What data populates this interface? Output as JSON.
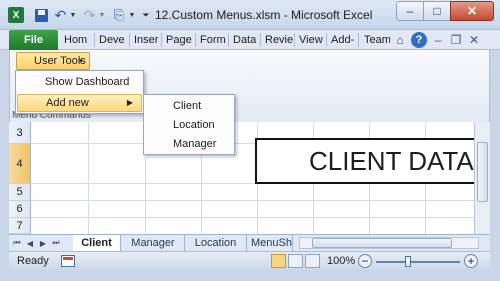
{
  "titlebar": {
    "app_icon": "excel-logo-icon",
    "app_icon_letter": "X",
    "title": "12.Custom Menus.xlsm - Microsoft Excel",
    "minimize": "–",
    "maximize": "□",
    "close": "✕"
  },
  "ribbon": {
    "file_tab": "File",
    "tabs": [
      "Hom",
      "Deve",
      "Inser",
      "Page",
      "Form",
      "Data",
      "Revie",
      "View",
      "Add-",
      "Team"
    ],
    "help_icon": "?",
    "window_controls": [
      "–",
      "❐",
      "✕"
    ]
  },
  "addins_group": {
    "user_tools_label": "User Tools",
    "group_label": "Menu Commands"
  },
  "user_tools_menu": {
    "items": [
      {
        "label": "Show Dashboard"
      },
      {
        "label": "Add new"
      }
    ]
  },
  "add_new_submenu": {
    "items": [
      {
        "label": "Client"
      },
      {
        "label": "Location"
      },
      {
        "label": "Manager"
      }
    ]
  },
  "grid": {
    "row_numbers": [
      "3",
      "4",
      "5",
      "6",
      "7"
    ],
    "active_row": "4",
    "client_data_text": "CLIENT DATA"
  },
  "sheet_tabs": {
    "tabs": [
      "Client",
      "Manager",
      "Location",
      "MenuSh"
    ],
    "active": "Client"
  },
  "statusbar": {
    "status": "Ready",
    "zoom": "100%",
    "zoom_out": "−",
    "zoom_in": "+"
  },
  "colors": {
    "file_tab": "#1d7a2c",
    "highlight": "#ffd16a",
    "close_button": "#c24b32"
  }
}
